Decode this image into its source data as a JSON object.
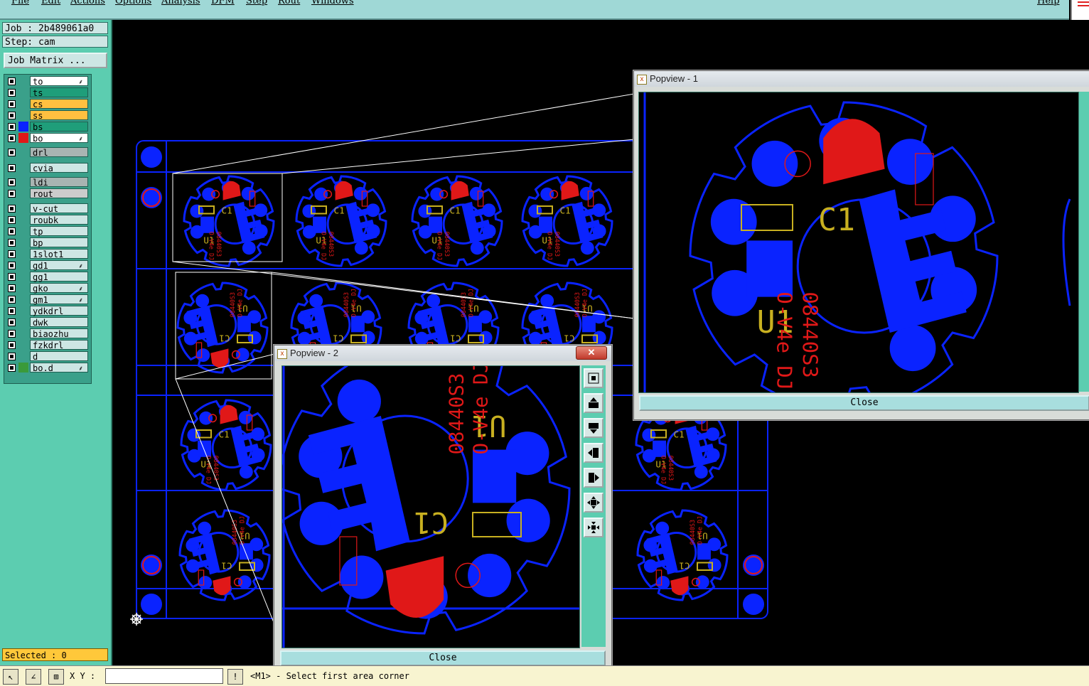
{
  "menubar": {
    "items": [
      "File",
      "Edit",
      "Actions",
      "Options",
      "Analysis",
      "DFM",
      "Step",
      "Rout",
      "Windows"
    ],
    "help": "Help"
  },
  "job": {
    "job_label": "Job : 2b489061a0",
    "step_label": "Step: cam",
    "matrix_button": "Job Matrix ..."
  },
  "layers": [
    {
      "name": "to",
      "color": "#ffffff",
      "mark": "&"
    },
    {
      "name": "ts",
      "color": "#1f9e7a",
      "mark": ""
    },
    {
      "name": "cs",
      "color": "#ffc040",
      "mark": ""
    },
    {
      "name": "ss",
      "color": "#ffc040",
      "mark": ""
    },
    {
      "name": "bs",
      "color": "#1f9e7a",
      "mark": ""
    },
    {
      "name": "bo",
      "color": "#ffffff",
      "mark": "&"
    },
    {
      "name": "drl",
      "color": "#a8b4b2",
      "mark": ""
    },
    {
      "name": "cvia",
      "color": "#cde6e4",
      "mark": ""
    },
    {
      "name": "ldi",
      "color": "#a8b4b2",
      "mark": ""
    },
    {
      "name": "rout",
      "color": "#cccccc",
      "mark": ""
    },
    {
      "name": "v-cut",
      "color": "#cde6e4",
      "mark": ""
    },
    {
      "name": "roubk",
      "color": "#cde6e4",
      "mark": ""
    },
    {
      "name": "tp",
      "color": "#cde6e4",
      "mark": ""
    },
    {
      "name": "bp",
      "color": "#cde6e4",
      "mark": ""
    },
    {
      "name": "1slot1",
      "color": "#cde6e4",
      "mark": ""
    },
    {
      "name": "gd1",
      "color": "#cde6e4",
      "mark": "&"
    },
    {
      "name": "gg1",
      "color": "#cde6e4",
      "mark": ""
    },
    {
      "name": "gko",
      "color": "#cde6e4",
      "mark": "&"
    },
    {
      "name": "gm1",
      "color": "#cde6e4",
      "mark": "&"
    },
    {
      "name": "ydkdrl",
      "color": "#cde6e4",
      "mark": ""
    },
    {
      "name": "dwk",
      "color": "#cde6e4",
      "mark": ""
    },
    {
      "name": "biaozhu",
      "color": "#cde6e4",
      "mark": ""
    },
    {
      "name": "fzkdrl",
      "color": "#cde6e4",
      "mark": ""
    },
    {
      "name": "d",
      "color": "#cde6e4",
      "mark": ""
    },
    {
      "name": "bo.d",
      "color": "#cde6e4",
      "mark": "&"
    }
  ],
  "selected": "Selected : 0",
  "statusbar": {
    "xy_label": "X Y :",
    "xy_value": "",
    "prompt": "<M1> - Select first area corner"
  },
  "popview1": {
    "title": "Popview - 1",
    "close": "Close"
  },
  "popview2": {
    "title": "Popview - 2",
    "close": "Close",
    "x": "✕"
  },
  "board_text": {
    "c1": "C1",
    "u1": "U1",
    "part": "08440S3",
    "rev": "O-V4e DJ"
  },
  "colors": {
    "copper": "#0a23ff",
    "silk": "#e01818",
    "pad": "#c8b020",
    "menubar": "#9fd8d6",
    "panel": "#5ccdb0"
  }
}
